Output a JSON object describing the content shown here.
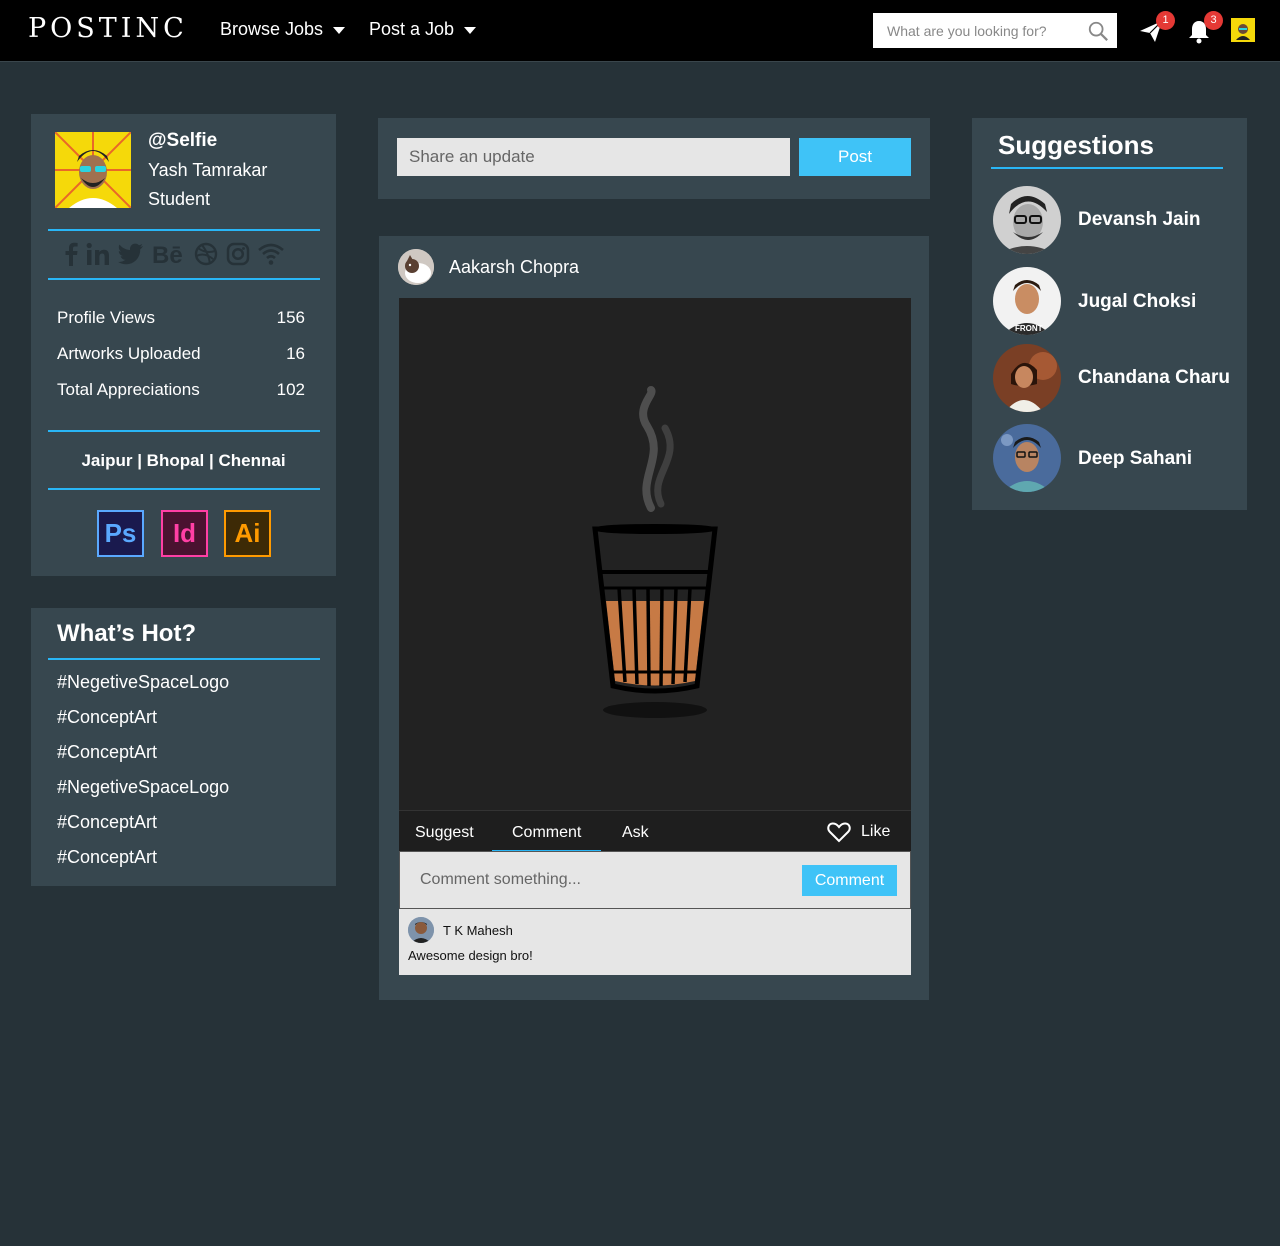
{
  "header": {
    "logo": "POSTINC",
    "nav": [
      {
        "label": "Browse Jobs"
      },
      {
        "label": "Post a Job"
      }
    ],
    "search_placeholder": "What are you looking for?",
    "messages_badge": "1",
    "notifications_badge": "3"
  },
  "profile": {
    "handle": "@Selfie",
    "name": "Yash Tamrakar",
    "role": "Student",
    "stats": [
      {
        "label": "Profile Views",
        "value": "156"
      },
      {
        "label": "Artworks Uploaded",
        "value": "16"
      },
      {
        "label": "Total Appreciations",
        "value": "102"
      }
    ],
    "cities": "Jaipur | Bhopal | Chennai",
    "apps": [
      "Ps",
      "Id",
      "Ai"
    ]
  },
  "whats_hot": {
    "title": "What’s Hot?",
    "tags": [
      "#NegetiveSpaceLogo",
      "#ConceptArt",
      "#ConceptArt",
      "#NegetiveSpaceLogo",
      "#ConceptArt",
      "#ConceptArt"
    ]
  },
  "share": {
    "placeholder": "Share an update",
    "post_label": "Post"
  },
  "post": {
    "author": "Aakarsh Chopra",
    "tabs": [
      "Suggest",
      "Comment",
      "Ask"
    ],
    "like_label": "Like",
    "comment_placeholder": "Comment something...",
    "comment_button": "Comment",
    "comments": [
      {
        "author": "T K Mahesh",
        "text": "Awesome design bro!"
      }
    ]
  },
  "suggestions": {
    "title": "Suggestions",
    "people": [
      "Devansh Jain",
      "Jugal Choksi",
      "Chandana Charu",
      "Deep Sahani"
    ]
  },
  "colors": {
    "background": "#263238",
    "panel": "#37474f",
    "accent": "#29b6f6",
    "button": "#3fc3f7",
    "topbar": "#000000",
    "badge": "#e53935"
  }
}
